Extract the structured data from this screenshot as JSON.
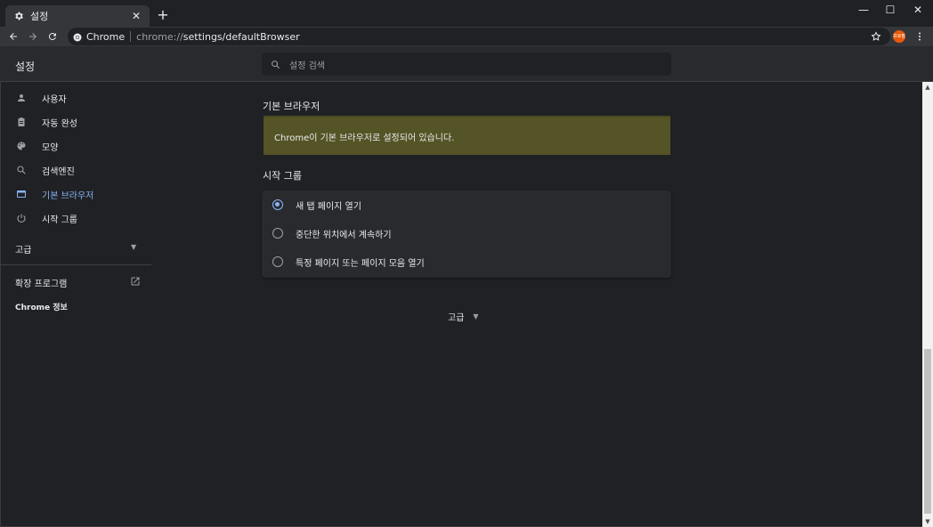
{
  "tab": {
    "title": "설정",
    "close": "✕",
    "new_tab": "+"
  },
  "window_controls": {
    "minimize": "—",
    "maximize": "☐",
    "close": "✕"
  },
  "omnibox": {
    "site_name": "Chrome",
    "url_prefix": "chrome://",
    "url_rest": "settings/defaultBrowser"
  },
  "profile": {
    "avatar_text": "프로필"
  },
  "header": {
    "title": "설정",
    "search_placeholder": "설정 검색"
  },
  "sidebar": {
    "items": [
      {
        "label": "사용자",
        "icon": "person-icon"
      },
      {
        "label": "자동 완성",
        "icon": "clipboard-icon"
      },
      {
        "label": "모양",
        "icon": "palette-icon"
      },
      {
        "label": "검색엔진",
        "icon": "search-icon"
      },
      {
        "label": "기본 브라우저",
        "icon": "browser-icon"
      },
      {
        "label": "시작 그룹",
        "icon": "power-icon"
      }
    ],
    "advanced": "고급",
    "extensions": "확장 프로그램",
    "about": "Chrome 정보"
  },
  "main": {
    "default_browser_title": "기본 브라우저",
    "default_browser_status": "Chrome이 기본 브라우저로 설정되어 있습니다.",
    "startup_title": "시작 그룹",
    "startup_options": [
      {
        "label": "새 탭 페이지 열기",
        "selected": true
      },
      {
        "label": "중단한 위치에서 계속하기",
        "selected": false
      },
      {
        "label": "특정 페이지 또는 페이지 모음 열기",
        "selected": false
      }
    ],
    "advanced": "고급"
  },
  "colors": {
    "accent": "#8ab4f8",
    "banner": "#555426",
    "background": "#202124"
  }
}
